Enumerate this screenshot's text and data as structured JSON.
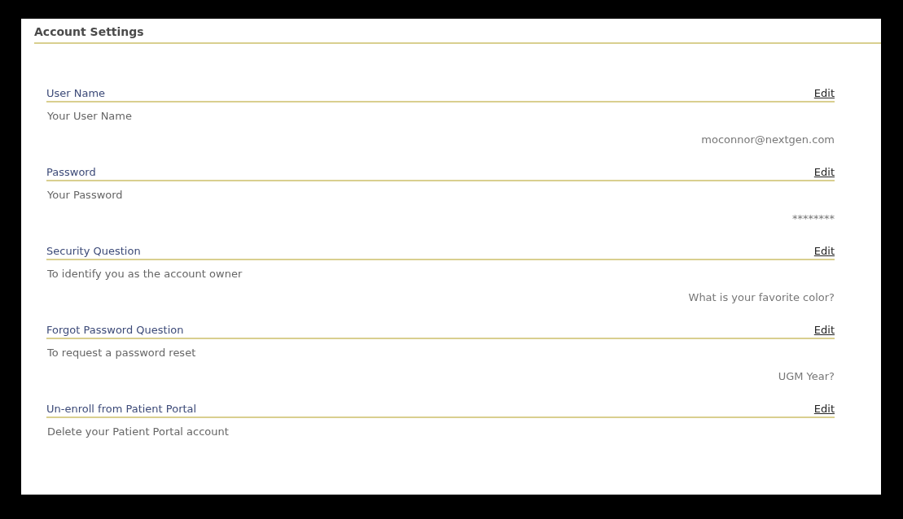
{
  "page": {
    "title": "Account Settings"
  },
  "sections": [
    {
      "heading": "User Name",
      "action": "Edit",
      "description": "Your User Name",
      "value": "moconnor@nextgen.com"
    },
    {
      "heading": "Password",
      "action": "Edit",
      "description": "Your Password",
      "value": "********"
    },
    {
      "heading": "Security Question",
      "action": "Edit",
      "description": "To identify you as the account owner",
      "value": "What is your favorite color?"
    },
    {
      "heading": "Forgot Password Question",
      "action": "Edit",
      "description": "To request a password reset",
      "value": "UGM Year?"
    },
    {
      "heading": "Un-enroll from Patient Portal",
      "action": "Edit",
      "description": "Delete your Patient Portal account"
    }
  ]
}
